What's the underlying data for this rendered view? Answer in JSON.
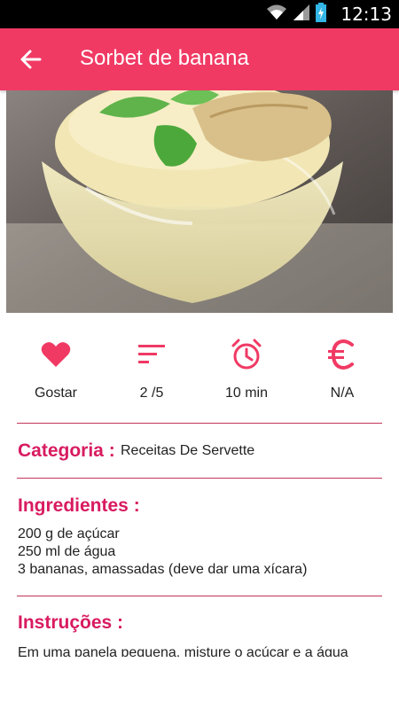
{
  "status_bar": {
    "time": "12:13",
    "icons": [
      "wifi-icon",
      "signal-icon",
      "battery-charging-icon"
    ]
  },
  "app_bar": {
    "title": "Sorbet de banana",
    "back_icon": "arrow-left-icon"
  },
  "hero_image": {
    "subject": "banana sorbet dessert glass with mint leaves"
  },
  "stats": [
    {
      "icon": "heart-icon",
      "label": "Gostar"
    },
    {
      "icon": "sort-lines-icon",
      "label": "2 /5"
    },
    {
      "icon": "alarm-clock-icon",
      "label": "10 min"
    },
    {
      "icon": "euro-icon",
      "label": "N/A"
    }
  ],
  "category": {
    "heading": "Categoria :",
    "value": "Receitas De Servette"
  },
  "ingredients": {
    "heading": "Ingredientes :",
    "items": [
      "200 g de açúcar",
      "250 ml de água",
      "3 bananas, amassadas (deve dar uma xícara)"
    ]
  },
  "instructions": {
    "heading": "Instruções :",
    "text": "Em uma panela pequena, misture o açúcar e a água"
  },
  "colors": {
    "primary": "#f03a64",
    "heading": "#d81b60",
    "divider": "#c3355a"
  }
}
